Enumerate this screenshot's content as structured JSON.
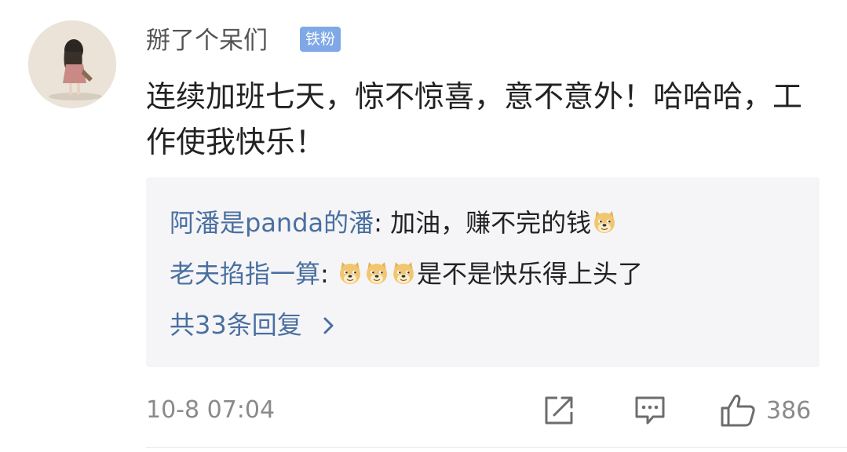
{
  "comment": {
    "username": "掰了个呆们",
    "badge": "铁粉",
    "text": "连续加班七天，惊不惊喜，意不意外！哈哈哈，工作使我快乐！",
    "timestamp": "10-8 07:04",
    "like_count": "386"
  },
  "replies": [
    {
      "name": "阿潘是panda的潘",
      "separator": ": ",
      "text": "加油，赚不完的钱",
      "emoji_before": 0,
      "emoji_after": 1
    },
    {
      "name": "老夫掐指一算",
      "separator": ": ",
      "text": "是不是快乐得上头了",
      "emoji_before": 3,
      "emoji_after": 0
    }
  ],
  "more_replies_label": "共33条回复",
  "icons": {
    "share": "share-icon",
    "comment": "comment-icon",
    "like": "thumbs-up-icon",
    "emoji": "doge-emoji-icon"
  },
  "colors": {
    "link": "#4a6fa0",
    "badge_bg": "#7fa8e6",
    "reply_bg": "#f5f5f7",
    "meta": "#8a8a8a"
  }
}
